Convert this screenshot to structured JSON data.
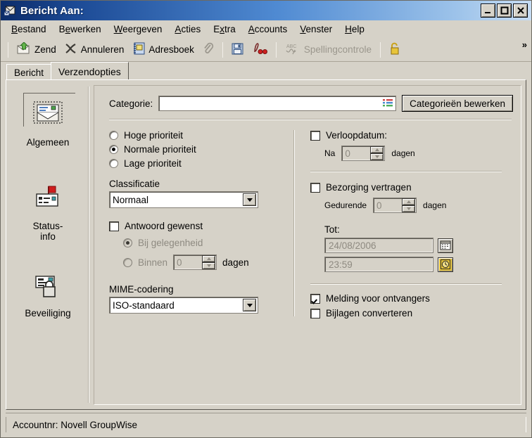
{
  "window": {
    "title": "Bericht Aan:",
    "icon": "mail-message-icon",
    "minimize": "_",
    "maximize": "□",
    "close": "✕"
  },
  "menubar": {
    "items": [
      {
        "label": "Bestand",
        "accel": "B"
      },
      {
        "label": "Bewerken",
        "accel": "e"
      },
      {
        "label": "Weergeven",
        "accel": "W"
      },
      {
        "label": "Acties",
        "accel": "A"
      },
      {
        "label": "Extra",
        "accel": "x"
      },
      {
        "label": "Accounts",
        "accel": "A"
      },
      {
        "label": "Venster",
        "accel": "V"
      },
      {
        "label": "Help",
        "accel": "H"
      }
    ]
  },
  "toolbar": {
    "send_label": "Zend",
    "send_icon": "send-envelope-icon",
    "cancel_label": "Annuleren",
    "cancel_icon": "cancel-x-icon",
    "addressbook_label": "Adresboek",
    "addressbook_icon": "address-book-icon",
    "attach_icon": "paperclip-icon",
    "save_icon": "floppy-save-icon",
    "signature_icon": "signature-icon",
    "spellcheck_label": "Spellingcontrole",
    "spellcheck_icon": "abc-spellcheck-icon",
    "security_icon": "padlock-icon",
    "overflow_label": "»"
  },
  "tabs": [
    {
      "label": "Bericht",
      "active": false
    },
    {
      "label": "Verzendopties",
      "active": true
    }
  ],
  "rail": {
    "items": [
      {
        "label": "Algemeen",
        "icon": "open-envelope-icon",
        "selected": true
      },
      {
        "label": "Status-\ninfo",
        "icon": "status-flag-icon",
        "selected": false
      },
      {
        "label": "Beveiliging",
        "icon": "lock-message-icon",
        "selected": false
      }
    ]
  },
  "form": {
    "category_label": "Categorie:",
    "category_value": "",
    "category_picker_icon": "category-list-icon",
    "edit_categories_button": "Categorieën bewerken",
    "priority": {
      "options": [
        {
          "label": "Hoge prioriteit",
          "selected": false
        },
        {
          "label": "Normale prioriteit",
          "selected": true
        },
        {
          "label": "Lage prioriteit",
          "selected": false
        }
      ]
    },
    "classification_label": "Classificatie",
    "classification_value": "Normaal",
    "reply_requested": {
      "label": "Antwoord gewenst",
      "checked": false,
      "options": [
        {
          "label": "Bij gelegenheid",
          "selected": true
        },
        {
          "label": "Binnen",
          "selected": false
        }
      ],
      "within_value": "0",
      "within_unit": "dagen"
    },
    "mime_label": "MIME-codering",
    "mime_value": "ISO-standaard",
    "expiration": {
      "label": "Verloopdatum:",
      "checked": false,
      "prefix": "Na",
      "value": "0",
      "unit": "dagen"
    },
    "delay": {
      "label": "Bezorging vertragen",
      "checked": false,
      "prefix": "Gedurende",
      "value": "0",
      "unit": "dagen",
      "until_label": "Tot:",
      "until_date": "24/08/2006",
      "until_time": "23:59",
      "calendar_icon": "calendar-icon",
      "clock_icon": "clock-icon"
    },
    "notify_recipients": {
      "label": "Melding voor ontvangers",
      "checked": true
    },
    "convert_attachments": {
      "label": "Bijlagen converteren",
      "checked": false
    }
  },
  "statusbar": {
    "text": "Accountnr: Novell GroupWise"
  },
  "colors": {
    "face": "#d6d2c8",
    "title_start": "#0c2c69",
    "title_end": "#c6dcf3",
    "text": "#000000",
    "disabled_text": "#8e8a81"
  }
}
